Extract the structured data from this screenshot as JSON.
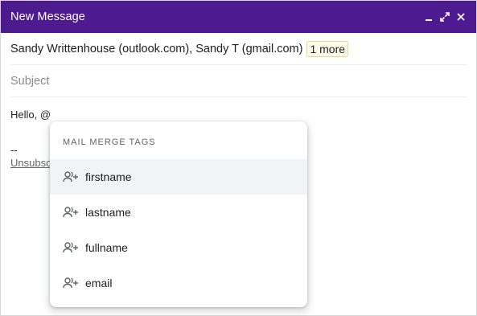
{
  "window": {
    "title": "New Message",
    "title_bar_color": "#4d1a8f",
    "controls": [
      "minimize-icon",
      "expand-icon",
      "close-icon"
    ]
  },
  "recipients": {
    "text": "Sandy Writtenhouse (outlook.com), Sandy T (gmail.com)",
    "more_chip": "1 more"
  },
  "subject": {
    "placeholder": "Subject"
  },
  "body": {
    "greeting": "Hello, @",
    "signature_dash": "--",
    "unsubscribe_visible": "Unsubsc"
  },
  "merge_dropdown": {
    "header": "MAIL MERGE TAGS",
    "items": [
      {
        "label": "firstname",
        "icon": "add-person-icon",
        "highlighted": true
      },
      {
        "label": "lastname",
        "icon": "add-person-icon",
        "highlighted": false
      },
      {
        "label": "fullname",
        "icon": "add-person-icon",
        "highlighted": false
      },
      {
        "label": "email",
        "icon": "add-person-icon",
        "highlighted": false
      }
    ]
  }
}
